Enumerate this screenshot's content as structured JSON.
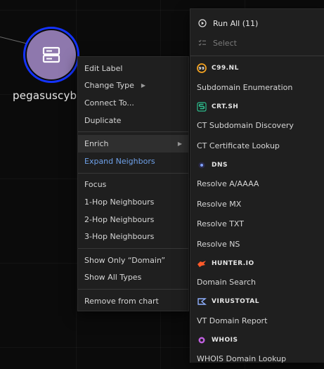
{
  "node": {
    "label": "pegasuscyb",
    "icon": "server-icon"
  },
  "context_menu": {
    "group1": [
      "Edit Label",
      "Change Type",
      "Connect To...",
      "Duplicate"
    ],
    "enrich": "Enrich",
    "expand": "Expand Neighbors",
    "group3": [
      "Focus",
      "1-Hop Neighbours",
      "2-Hop Neighbours",
      "3-Hop Neighbours"
    ],
    "group4": [
      "Show Only “Domain”",
      "Show All Types"
    ],
    "remove": "Remove from chart"
  },
  "submenu": {
    "run_all": "Run All (11)",
    "select": "Select",
    "providers": [
      {
        "name": "C99.NL",
        "icon": "c99-logo-icon",
        "actions": [
          "Subdomain Enumeration"
        ]
      },
      {
        "name": "CRT.SH",
        "icon": "crtsh-logo-icon",
        "actions": [
          "CT Subdomain Discovery",
          "CT Certificate Lookup"
        ]
      },
      {
        "name": "DNS",
        "icon": "dns-logo-icon",
        "actions": [
          "Resolve A/AAAA",
          "Resolve MX",
          "Resolve TXT",
          "Resolve NS"
        ]
      },
      {
        "name": "HUNTER.IO",
        "icon": "hunter-logo-icon",
        "actions": [
          "Domain Search"
        ]
      },
      {
        "name": "VIRUSTOTAL",
        "icon": "virustotal-logo-icon",
        "actions": [
          "VT Domain Report"
        ]
      },
      {
        "name": "WHOIS",
        "icon": "whois-logo-icon",
        "actions": [
          "WHOIS Domain Lookup"
        ]
      }
    ]
  },
  "colors": {
    "accent_link": "#6ea0e8",
    "node_fill": "#8e78ad",
    "node_ring": "#1433ff",
    "crtsh": "#2fbf8f",
    "hunter": "#ff5a2a"
  }
}
